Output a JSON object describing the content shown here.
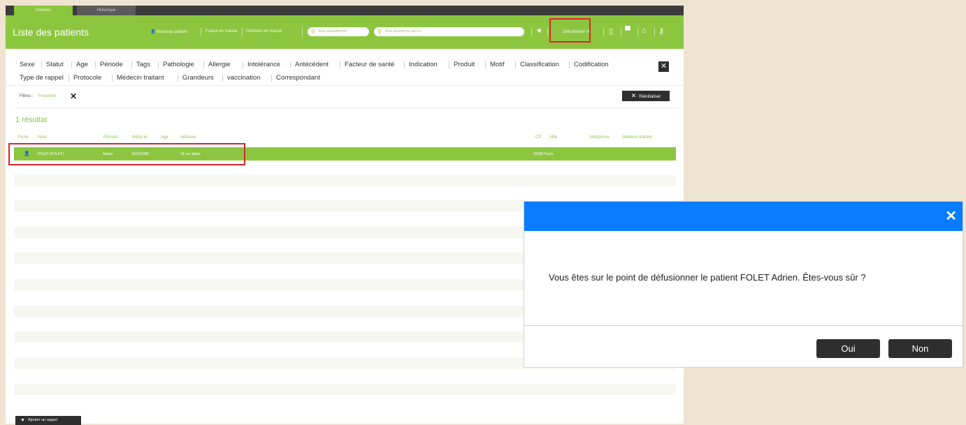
{
  "tabs": [
    {
      "label": "Patients"
    },
    {
      "label": "Historique"
    }
  ],
  "header": {
    "title": "Liste des patients",
    "buttons": [
      "Nouveau patient",
      "Fusion en masse",
      "Défusion en masse"
    ],
    "search_short": "Rien actuellement",
    "search_long": "Rien présent ou rien ici",
    "defusionner": "Défusionner"
  },
  "filters": {
    "row1": [
      "Sexe",
      "Statut",
      "Age",
      "Période",
      "Tags",
      "Pathologie",
      "Allergie",
      "Intolérance",
      "Antécédent",
      "Facteur de santé",
      "Indication",
      "Produit",
      "Motif",
      "Classification",
      "Codification"
    ],
    "row2": [
      "Type de rappel",
      "Protocole",
      "Médecin traitant",
      "Grandeurs",
      "vaccination",
      "Correspondant"
    ],
    "close": "✕"
  },
  "active_filters": {
    "label": "Filtres :",
    "value": "Fusionné",
    "reset": "Réinitialiser"
  },
  "results": {
    "count": "1 résultat",
    "columns": [
      "Fiche",
      "Nom",
      "Prénom",
      "Né(e) le",
      "Age",
      "Adresse",
      "CP",
      "Ville",
      "Mél/phone",
      "Médecin traitant"
    ],
    "rows": [
      {
        "nom": "FOLET (FOLET)",
        "prenom": "Adrien",
        "date": "12/02/1980",
        "adresse": "18 rue alliant",
        "cp_ville": "33380 Fours"
      }
    ]
  },
  "footer": {
    "add_rappel": "Ajouter un rappel"
  },
  "modal": {
    "message": "Vous êtes sur le point de défusionner le patient FOLET Adrien. Êtes-vous sûr ?",
    "yes": "Oui",
    "no": "Non",
    "close": "✕"
  },
  "colors": {
    "accent": "#8cc63f",
    "modal_header": "#0a7cff",
    "highlight": "#d9262b",
    "dark_button": "#2e2e2e"
  }
}
